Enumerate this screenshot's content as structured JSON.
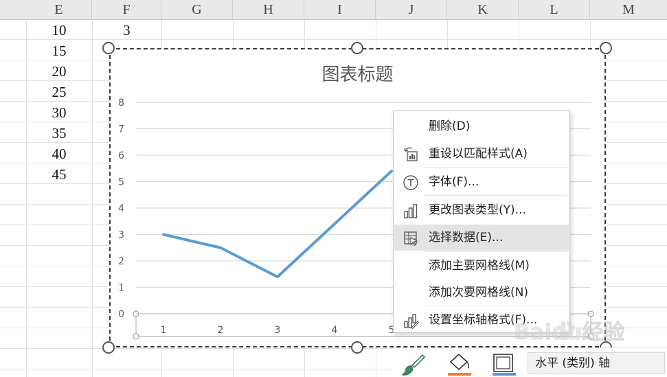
{
  "columns": [
    "E",
    "F",
    "G",
    "H",
    "I",
    "J",
    "K",
    "L",
    "M"
  ],
  "cells": {
    "col_e": [
      "10",
      "15",
      "20",
      "25",
      "30",
      "35",
      "40",
      "45"
    ],
    "col_f": [
      "3"
    ]
  },
  "chart": {
    "title": "图表标题",
    "line_color": "#5b9bd5"
  },
  "chart_data": {
    "type": "line",
    "title": "图表标题",
    "categories": [
      "1",
      "2",
      "3",
      "4",
      "5"
    ],
    "series": [
      {
        "values": [
          3,
          2.5,
          1.4,
          3.4,
          5.4
        ]
      }
    ],
    "ylim": [
      0,
      8
    ],
    "yticks": [
      "0",
      "1",
      "2",
      "3",
      "4",
      "5",
      "6",
      "7",
      "8"
    ],
    "grid": true,
    "xlabel": "",
    "ylabel": ""
  },
  "context_menu": {
    "items": [
      {
        "label": "删除(D)",
        "icon": "none"
      },
      {
        "label": "重设以匹配样式(A)",
        "icon": "reset-style-icon"
      },
      {
        "label": "字体(F)...",
        "icon": "font-icon"
      },
      {
        "label": "更改图表类型(Y)...",
        "icon": "chart-type-icon"
      },
      {
        "label": "选择数据(E)...",
        "icon": "select-data-icon",
        "highlighted": true
      },
      {
        "label": "添加主要网格线(M)",
        "icon": "none"
      },
      {
        "label": "添加次要网格线(N)",
        "icon": "none"
      },
      {
        "label": "设置坐标轴格式(F)...",
        "icon": "format-axis-icon"
      }
    ]
  },
  "format_toolbar": {
    "style_icon": "paintbrush-icon",
    "fill_icon": "paint-bucket-icon",
    "fill_color": "#ed7d31",
    "outline_icon": "outline-icon",
    "outline_color": "#5b9bd5",
    "element_select_value": "水平 (类别) 轴"
  },
  "watermark": {
    "text": "Baidu经验",
    "icon": "paw-icon"
  }
}
